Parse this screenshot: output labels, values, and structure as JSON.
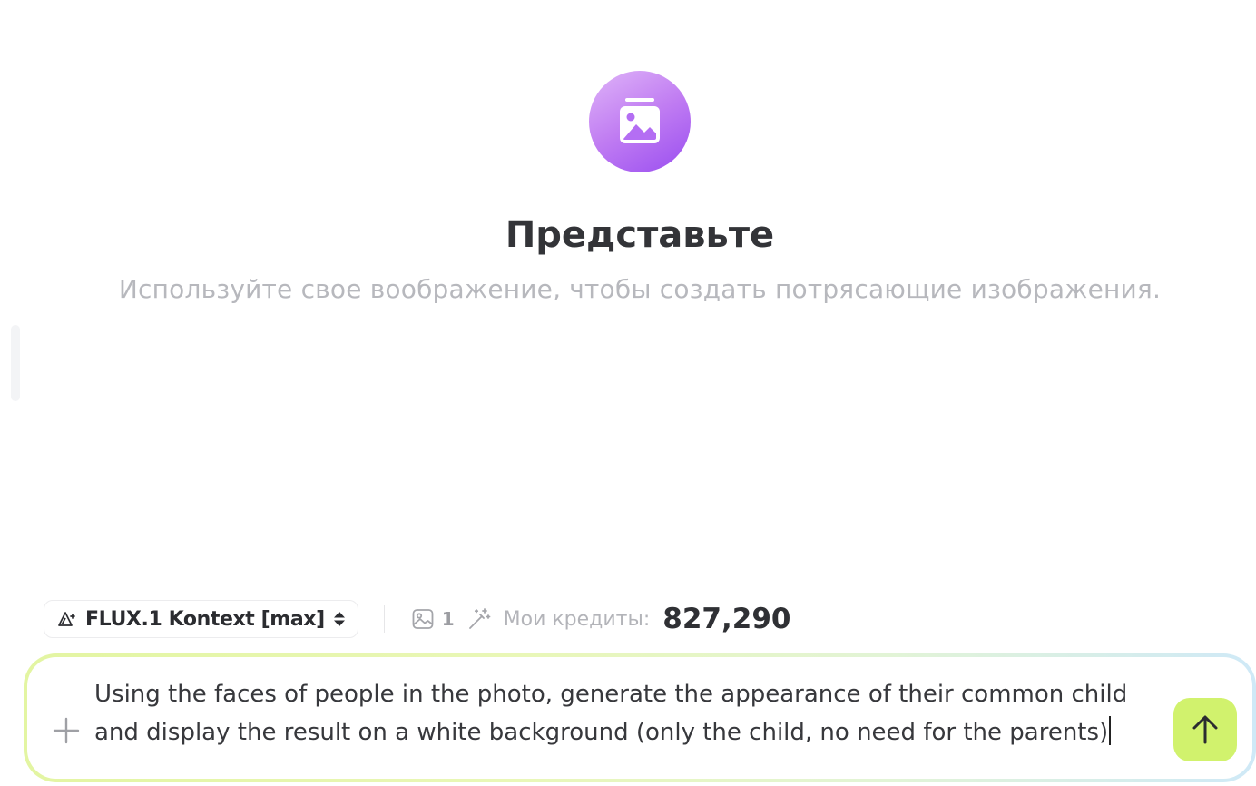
{
  "hero": {
    "icon": "image-stack-icon",
    "title": "Представьте",
    "subtitle": "Используйте свое воображение, чтобы создать потрясающие изображения."
  },
  "toolbar": {
    "model_icon": "triangle-sparkle-icon",
    "model_name": "FLUX.1 Kontext [max]",
    "image_count_icon": "image-icon",
    "image_count": "1",
    "enhance_icon": "magic-wand-icon",
    "credits_label": "Мои кредиты:",
    "credits_value": "827,290"
  },
  "composer": {
    "prompt_text": "Using the faces of people in the photo, generate the appearance of their common child\nand display the result on a white background (only the child, no need for the parents)",
    "attach_icon": "plus-icon",
    "send_icon": "arrow-up-icon"
  },
  "colors": {
    "hero_gradient_start": "#dfb4f8",
    "hero_gradient_end": "#9a4ef0",
    "send_button": "#d1f26d",
    "composer_border_start": "#e3f5a2",
    "composer_border_end": "#cfe9f7"
  }
}
